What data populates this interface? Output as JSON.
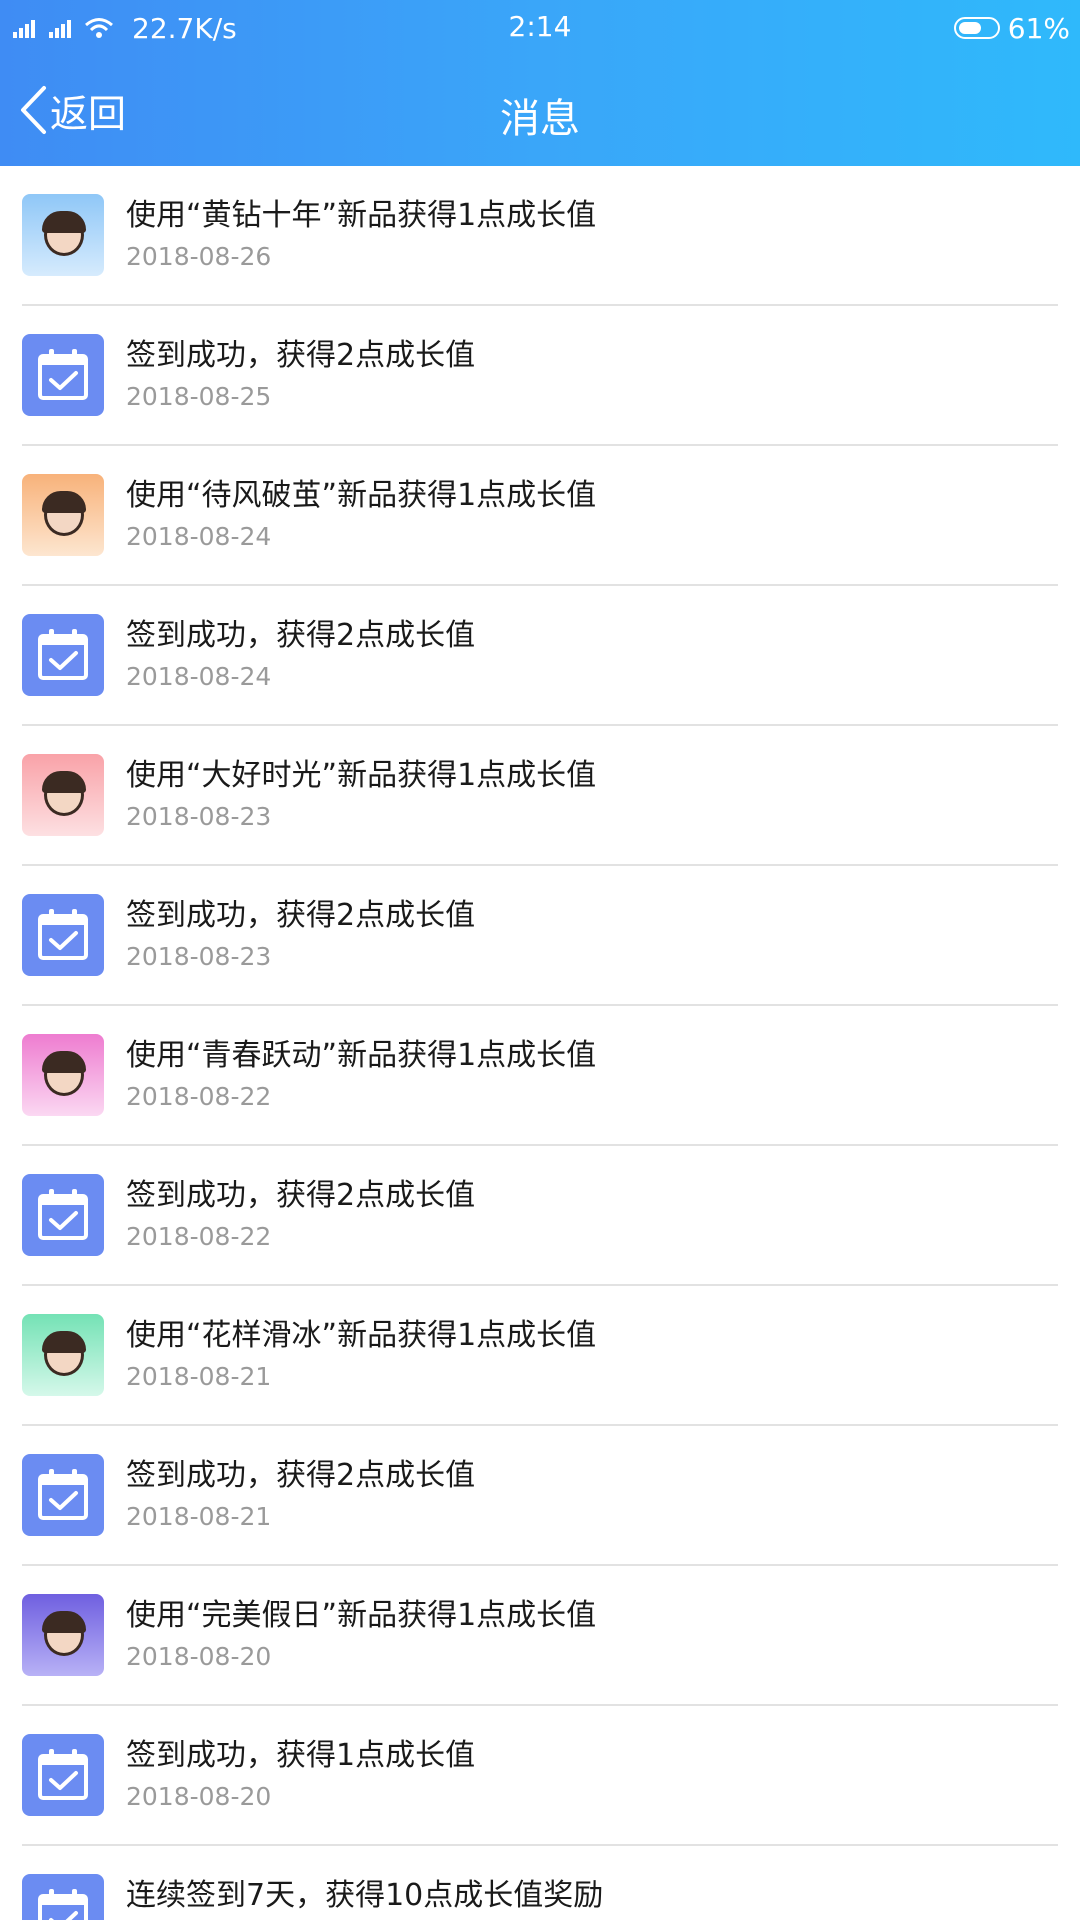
{
  "status_bar": {
    "network_speed": "22.7K/s",
    "time": "2:14",
    "battery": "61%",
    "battery_level": 0.61
  },
  "navbar": {
    "back_label": "返回",
    "title": "消息"
  },
  "colors": {
    "header_start": "#3f8cf4",
    "header_end": "#2fb9fb",
    "calendar_icon": "#6b8cf2"
  },
  "messages": [
    {
      "icon": "avatar-gold",
      "title": "使用“黄钻十年”新品获得1点成长值",
      "date": "2018-08-26"
    },
    {
      "icon": "calendar-check",
      "title": "签到成功，获得2点成长值",
      "date": "2018-08-25"
    },
    {
      "icon": "avatar-orange",
      "title": "使用“待风破茧”新品获得1点成长值",
      "date": "2018-08-24"
    },
    {
      "icon": "calendar-check",
      "title": "签到成功，获得2点成长值",
      "date": "2018-08-24"
    },
    {
      "icon": "avatar-pink",
      "title": "使用“大好时光”新品获得1点成长值",
      "date": "2018-08-23"
    },
    {
      "icon": "calendar-check",
      "title": "签到成功，获得2点成长值",
      "date": "2018-08-23"
    },
    {
      "icon": "avatar-magenta",
      "title": "使用“青春跃动”新品获得1点成长值",
      "date": "2018-08-22"
    },
    {
      "icon": "calendar-check",
      "title": "签到成功，获得2点成长值",
      "date": "2018-08-22"
    },
    {
      "icon": "avatar-green",
      "title": "使用“花样滑冰”新品获得1点成长值",
      "date": "2018-08-21"
    },
    {
      "icon": "calendar-check",
      "title": "签到成功，获得2点成长值",
      "date": "2018-08-21"
    },
    {
      "icon": "avatar-purple",
      "title": "使用“完美假日”新品获得1点成长值",
      "date": "2018-08-20"
    },
    {
      "icon": "calendar-check",
      "title": "签到成功，获得1点成长值",
      "date": "2018-08-20"
    },
    {
      "icon": "calendar-check",
      "title": "连续签到7天，获得10点成长值奖励",
      "date": ""
    }
  ]
}
